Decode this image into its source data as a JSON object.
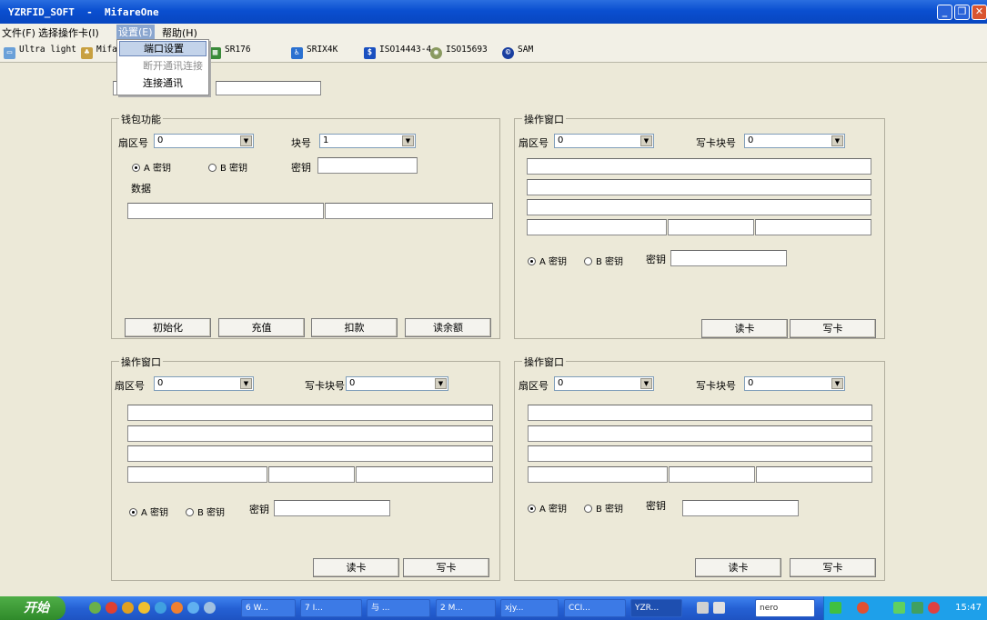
{
  "window": {
    "title": "YZRFID_SOFT  -  MifareOne",
    "min": "_",
    "max": "❐",
    "close": "✕"
  },
  "menu": {
    "file": "文件(F)",
    "select_card": "选择操作卡(I)",
    "settings": "设置(E)",
    "help": "帮助(H)"
  },
  "settings_menu": {
    "port_setting": "端口设置",
    "disconnect": "断开通讯连接",
    "connect": "连接通讯"
  },
  "toolbar": [
    "Ultra light",
    "Mifa",
    "SR176",
    "SRIX4K",
    "ISO14443-4",
    "ISO15693",
    "SAM"
  ],
  "wallet": {
    "title": "钱包功能",
    "sector_label": "扇区号",
    "sector_value": "0",
    "block_label": "块号",
    "block_value": "1",
    "key_a": "A 密钥",
    "key_b": "B 密钥",
    "key_label": "密钥",
    "data_label": "数据",
    "btn_init": "初始化",
    "btn_charge": "充值",
    "btn_deduct": "扣款",
    "btn_balance": "读余额"
  },
  "op": {
    "title": "操作窗口",
    "sector_label": "扇区号",
    "sector_value": "0",
    "write_block_label": "写卡块号",
    "write_block_value": "0",
    "key_a": "A 密钥",
    "key_b": "B 密钥",
    "key_label": "密钥",
    "btn_read": "读卡",
    "btn_write": "写卡"
  },
  "taskbar": {
    "start": "开始",
    "tasks": [
      "6 W...",
      "7 I...",
      "与 ...",
      "2 M...",
      "xjy...",
      "CCI...",
      "YZR...",
      "nero"
    ],
    "clock": "15:47"
  }
}
